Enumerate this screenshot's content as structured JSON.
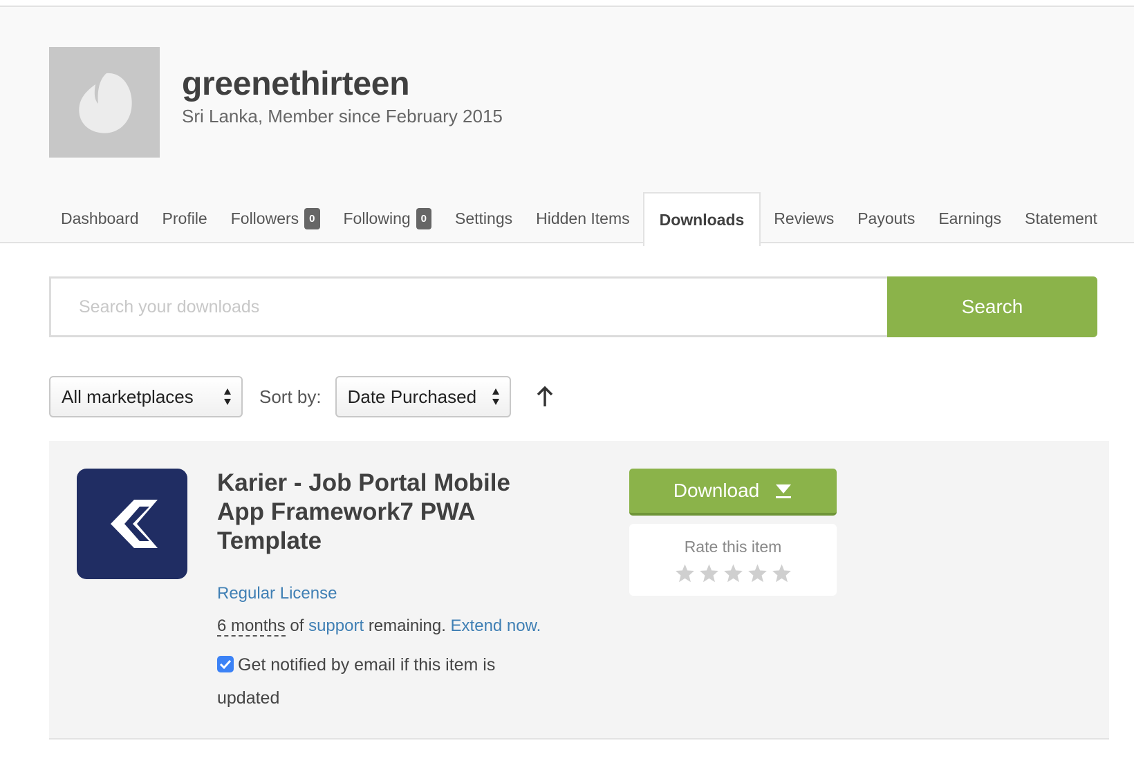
{
  "profile": {
    "username": "greenethirteen",
    "member_info": "Sri Lanka, Member since February 2015"
  },
  "tabs": [
    {
      "label": "Dashboard"
    },
    {
      "label": "Profile"
    },
    {
      "label": "Followers",
      "badge": "0"
    },
    {
      "label": "Following",
      "badge": "0"
    },
    {
      "label": "Settings"
    },
    {
      "label": "Hidden Items"
    },
    {
      "label": "Downloads",
      "active": true
    },
    {
      "label": "Reviews"
    },
    {
      "label": "Payouts"
    },
    {
      "label": "Earnings"
    },
    {
      "label": "Statement"
    }
  ],
  "search": {
    "placeholder": "Search your downloads",
    "value": "",
    "button_label": "Search"
  },
  "filters": {
    "marketplace": "All marketplaces",
    "sort_label": "Sort by:",
    "sort_value": "Date Purchased"
  },
  "item": {
    "title": "Karier - Job Portal Mobile App Framework7 PWA Template",
    "license": "Regular License",
    "support_duration": "6 months",
    "support_of": "of",
    "support_link": "support",
    "support_remaining": "remaining.",
    "extend_link": "Extend now.",
    "notify_label": "Get notified by email if this item is updated",
    "notify_checked": true,
    "download_label": "Download",
    "rate_label": "Rate this item",
    "rating": 0,
    "rating_max": 5
  },
  "colors": {
    "accent_green": "#8bb34a",
    "link_blue": "#3f7fb4",
    "thumb_navy": "#202d63"
  }
}
